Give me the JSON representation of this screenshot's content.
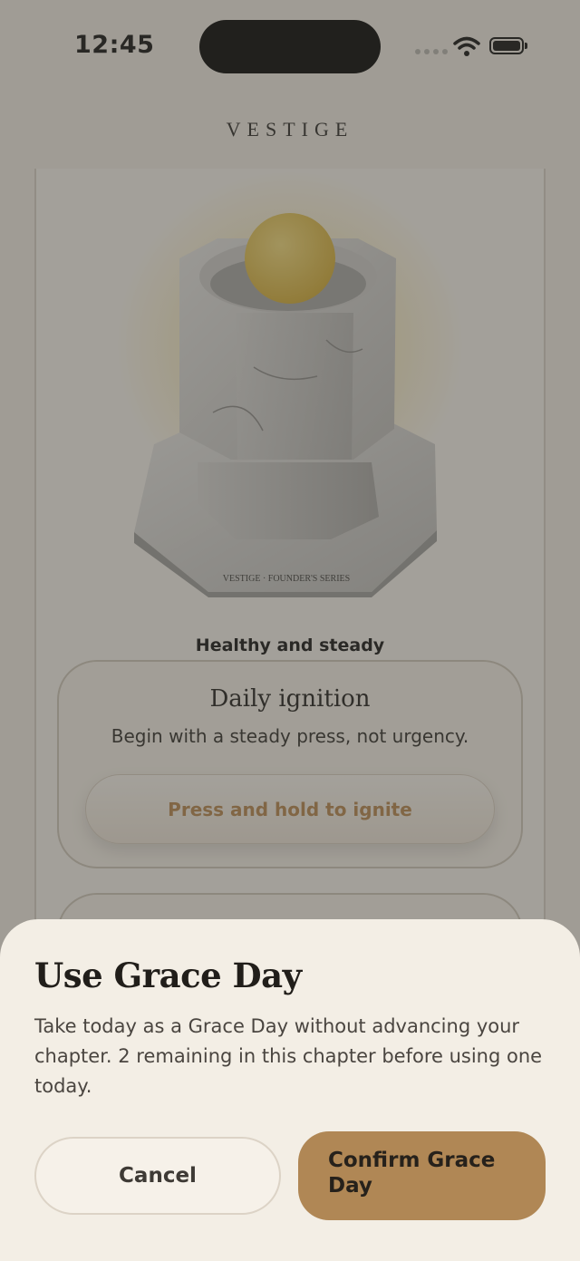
{
  "status_bar": {
    "time": "12:45"
  },
  "header": {
    "brand": "VESTIGE"
  },
  "hero": {
    "engraving": "VESTIGE · FOUNDER'S SERIES",
    "status": "Healthy and steady"
  },
  "ignition_card": {
    "title": "Daily ignition",
    "subtitle": "Begin with a steady press, not urgency.",
    "button_label": "Press and hold to ignite"
  },
  "grace_sheet": {
    "title": "Use Grace Day",
    "body": "Take today as a Grace Day without advancing your chapter. 2 remaining in this chapter before using one today.",
    "cancel_label": "Cancel",
    "confirm_label": "Confirm Grace Day"
  },
  "colors": {
    "accent": "#b08755",
    "orb": "#d9b23b",
    "sheet_bg": "#f3eee5",
    "ignite_text": "#b8874e"
  }
}
